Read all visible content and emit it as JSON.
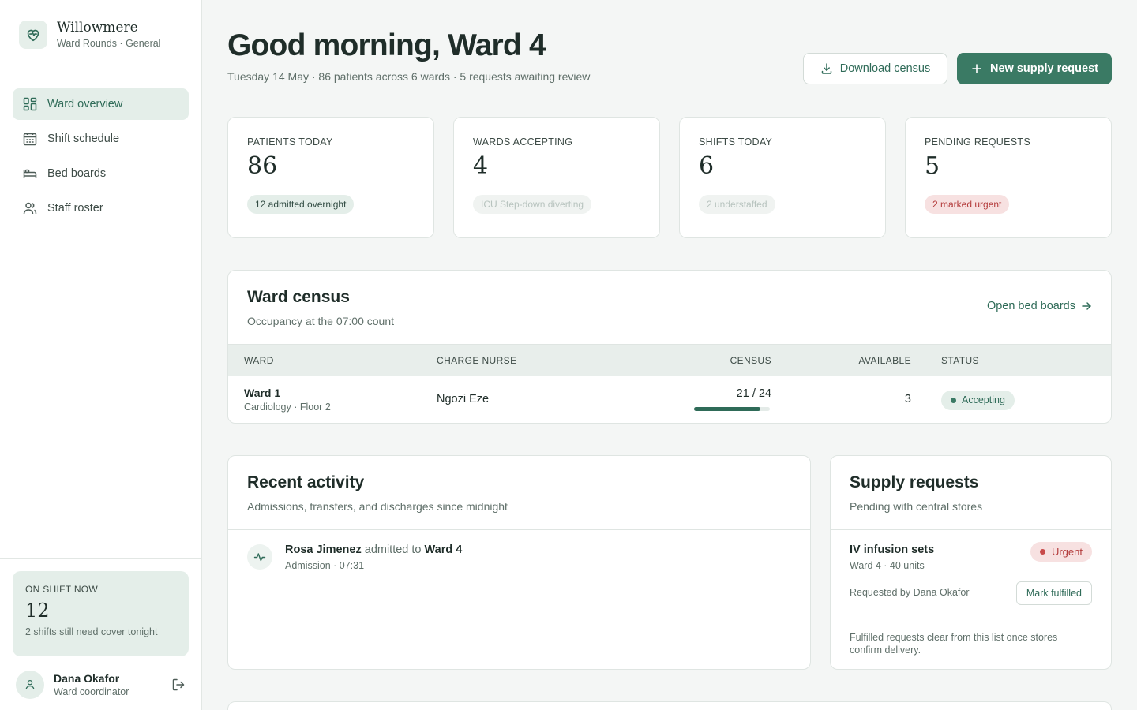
{
  "brand": {
    "name": "Willowmere",
    "subtitle": "Ward Rounds · General"
  },
  "nav": [
    {
      "label": "Ward overview",
      "icon": "grid-icon",
      "active": true
    },
    {
      "label": "Shift schedule",
      "icon": "calendar-icon"
    },
    {
      "label": "Bed boards",
      "icon": "bed-icon"
    },
    {
      "label": "Staff roster",
      "icon": "users-icon"
    }
  ],
  "on_shift": {
    "label": "ON SHIFT NOW",
    "value": "12",
    "note": "2 shifts still need cover tonight"
  },
  "user": {
    "name": "Dana Okafor",
    "role": "Ward coordinator"
  },
  "header": {
    "title": "Good morning, Ward 4",
    "subtitle": "Tuesday 14 May · 86 patients across 6 wards · 5 requests awaiting review",
    "download_label": "Download census",
    "new_request_label": "New supply request"
  },
  "stats": [
    {
      "label": "PATIENTS TODAY",
      "value": "86",
      "chip": "12 admitted overnight",
      "tone": "green"
    },
    {
      "label": "WARDS ACCEPTING",
      "value": "4",
      "chip": "ICU Step-down diverting",
      "tone": "muted"
    },
    {
      "label": "SHIFTS TODAY",
      "value": "6",
      "chip": "2 understaffed",
      "tone": "muted"
    },
    {
      "label": "PENDING REQUESTS",
      "value": "5",
      "chip": "2 marked urgent",
      "tone": "red"
    }
  ],
  "census": {
    "title": "Ward census",
    "subtitle": "Occupancy at the 07:00 count",
    "link": "Open bed boards",
    "columns": [
      "WARD",
      "CHARGE NURSE",
      "CENSUS",
      "AVAILABLE",
      "STATUS"
    ],
    "rows": [
      {
        "ward": "Ward 1",
        "detail": "Cardiology · Floor 2",
        "nurse": "Ngozi Eze",
        "census": "21 / 24",
        "occupancy": 0.875,
        "available": "3",
        "status": "Accepting"
      }
    ]
  },
  "activity": {
    "title": "Recent activity",
    "subtitle": "Admissions, transfers, and discharges since midnight",
    "items": [
      {
        "person": "Rosa Jimenez",
        "action": "admitted to",
        "target": "Ward 4",
        "meta": "Admission · 07:31"
      }
    ]
  },
  "supply": {
    "title": "Supply requests",
    "subtitle": "Pending with central stores",
    "items": [
      {
        "name": "IV infusion sets",
        "meta": "Ward 4 · 40 units",
        "badge": "Urgent",
        "requested_by": "Requested by Dana Okafor",
        "action": "Mark fulfilled"
      }
    ],
    "footnote": "Fulfilled requests clear from this list once stores confirm delivery."
  },
  "colors": {
    "accent": "#3a7a64",
    "urgent": "#b33a3a",
    "background": "#f4f6f5"
  }
}
